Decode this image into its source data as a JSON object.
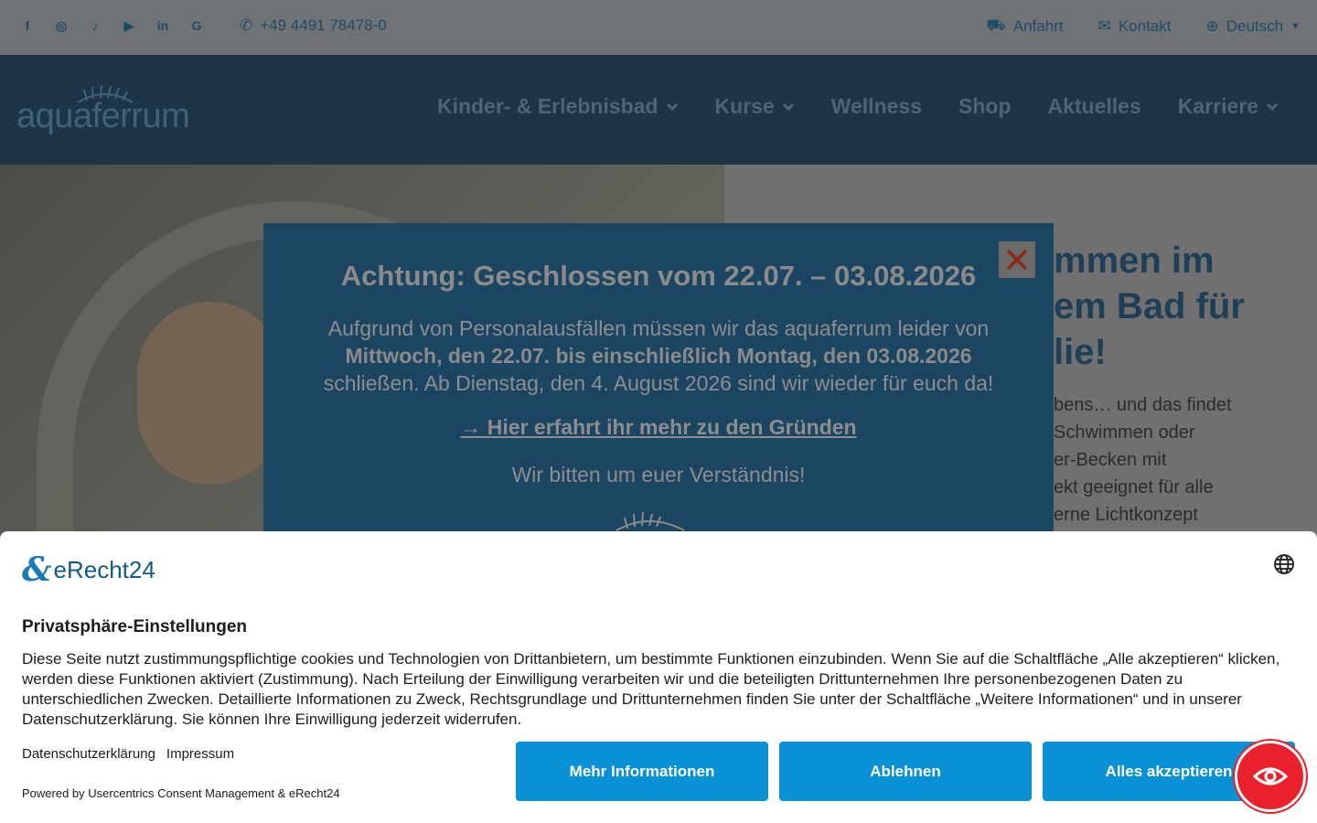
{
  "topbar": {
    "social_icons": [
      "facebook-icon",
      "instagram-icon",
      "tiktok-icon",
      "youtube-icon",
      "linkedin-icon",
      "google-icon"
    ],
    "phone": "+49 4491 78478-0",
    "directions": "Anfahrt",
    "contact": "Kontakt",
    "language": "Deutsch"
  },
  "nav": {
    "logo_text": "aquaferrum",
    "items": [
      {
        "label": "Kinder- & Erlebnisbad",
        "dropdown": true
      },
      {
        "label": "Kurse",
        "dropdown": true
      },
      {
        "label": "Wellness",
        "dropdown": false
      },
      {
        "label": "Shop",
        "dropdown": false
      },
      {
        "label": "Aktuelles",
        "dropdown": false
      },
      {
        "label": "Karriere",
        "dropdown": true
      }
    ]
  },
  "hero": {
    "heading_fragment_1": "mmen im",
    "heading_fragment_2": "em Bad für",
    "heading_fragment_3": "lie!",
    "text_lines": [
      "bens… und das findet",
      "Schwimmen oder",
      "er-Becken mit",
      "ekt geeignet für alle",
      "erne Lichtkonzept"
    ]
  },
  "popup": {
    "title": "Achtung: Geschlossen vom 22.07. – 03.08.2026",
    "line1": "Aufgrund von Personalausfällen müssen wir das aquaferrum leider von",
    "line2_bold": "Mittwoch, den 22.07. bis einschließlich Montag, den 03.08.2026",
    "line3": "schließen. Ab Dienstag, den 4. August 2026 sind wir wieder für euch da!",
    "link": "→ Hier erfahrt ihr mehr zu den Gründen",
    "thanks": "Wir bitten um euer Verständnis!"
  },
  "consent": {
    "brand": "eRecht24",
    "heading": "Privatsphäre-Einstellungen",
    "text": "Diese Seite nutzt zustimmungspflichtige cookies und Technologien von Drittanbietern, um bestimmte Funktionen einzubinden. Wenn Sie auf die Schaltfläche „Alle akzeptieren“ klicken, werden diese Funktionen aktiviert (Zustimmung). Nach Erteilung der Einwilligung verarbeiten wir und die beteiligten Drittunternehmen Ihre personenbezogenen Daten zu unterschiedlichen Zwecken. Detaillierte Informationen zu Zweck, Rechtsgrundlage und Drittunternehmen finden Sie unter der Schaltfläche „Weitere Informationen“ und in unserer Datenschutzerklärung. Sie können Ihre Einwilligung jederzeit widerrufen.",
    "privacy_link": "Datenschutzerklärung",
    "imprint_link": "Impressum",
    "powered": "Powered by Usercentrics Consent Management & eRecht24",
    "more_button": "Mehr Informationen",
    "decline_button": "Ablehnen",
    "accept_button": "Alles akzeptieren"
  },
  "colors": {
    "accent_blue": "#0990d5",
    "fab_red": "#e8212b",
    "popup_bg": "#1c4562"
  }
}
